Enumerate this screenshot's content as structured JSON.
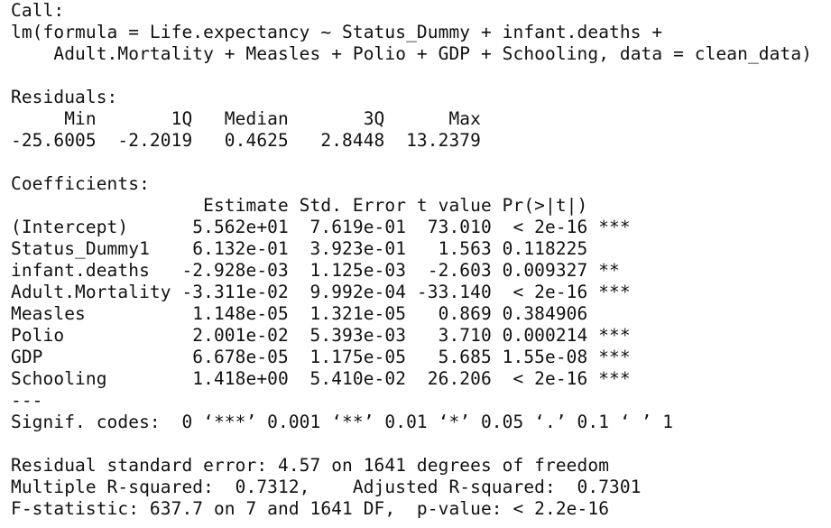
{
  "console_output": {
    "call": {
      "header": "Call:",
      "line1": "lm(formula = Life.expectancy ~ Status_Dummy + infant.deaths +",
      "line2": "    Adult.Mortality + Measles + Polio + GDP + Schooling, data = clean_data)"
    },
    "residuals": {
      "header": "Residuals:",
      "labels": "     Min       1Q   Median       3Q      Max ",
      "values": "-25.6005  -2.2019   0.4625   2.8448  13.2379 "
    },
    "coefficients": {
      "header": "Coefficients:",
      "column_header": "                  Estimate Std. Error t value Pr(>|t|)    ",
      "rows": [
        "(Intercept)      5.562e+01  7.619e-01  73.010  < 2e-16 ***",
        "Status_Dummy1    6.132e-01  3.923e-01   1.563 0.118225    ",
        "infant.deaths   -2.928e-03  1.125e-03  -2.603 0.009327 ** ",
        "Adult.Mortality -3.311e-02  9.992e-04 -33.140  < 2e-16 ***",
        "Measles          1.148e-05  1.321e-05   0.869 0.384906    ",
        "Polio            2.001e-02  5.393e-03   3.710 0.000214 ***",
        "GDP              6.678e-05  1.175e-05   5.685 1.55e-08 ***",
        "Schooling        1.418e+00  5.410e-02  26.206  < 2e-16 ***"
      ],
      "separator": "---",
      "signif_codes": "Signif. codes:  0 ‘***’ 0.001 ‘**’ 0.01 ‘*’ 0.05 ‘.’ 0.1 ‘ ’ 1"
    },
    "summary": {
      "residual_se": "Residual standard error: 4.57 on 1641 degrees of freedom",
      "r_squared": "Multiple R-squared:  0.7312,\tAdjusted R-squared:  0.7301 ",
      "f_statistic": "F-statistic: 637.7 on 7 and 1641 DF,  p-value: < 2.2e-16"
    }
  }
}
